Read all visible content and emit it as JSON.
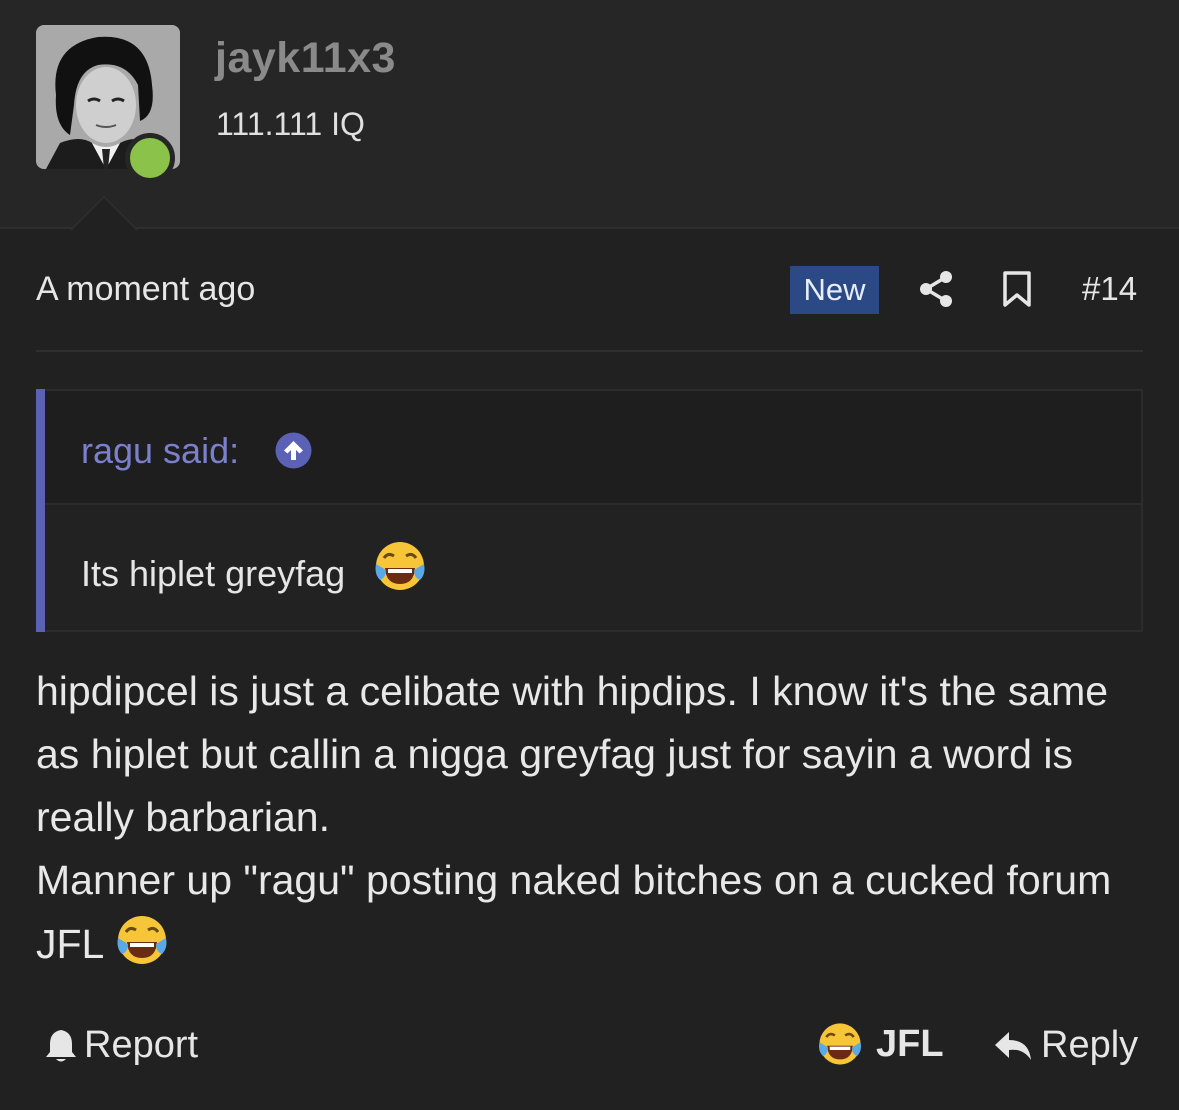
{
  "user": {
    "username": "jayk11x3",
    "title": "111.111 IQ",
    "status_color": "#8bc34a"
  },
  "meta": {
    "time": "A moment ago",
    "new_badge": "New",
    "share_icon": "share-icon",
    "bookmark_icon": "bookmark-icon",
    "post_number": "#14"
  },
  "quote": {
    "author": "ragu said:",
    "arrow_icon": "arrow-up-circle-icon",
    "text": "Its hiplet greyfag",
    "emoji": "face-with-tears-of-joy"
  },
  "body": {
    "paragraph1": "hipdipcel is just a celibate with hipdips. I know it's the same as hiplet but callin a nigga greyfag just for sayin a word is really barbarian.",
    "paragraph2": "Manner up \"ragu\" posting naked bitches on a cucked forum JFL",
    "emoji": "face-with-tears-of-joy"
  },
  "actions": {
    "report": "Report",
    "jfl": "JFL",
    "reply": "Reply"
  },
  "colors": {
    "background": "#212121",
    "quote_accent": "#5b61b5",
    "badge": "#2b4a85"
  }
}
